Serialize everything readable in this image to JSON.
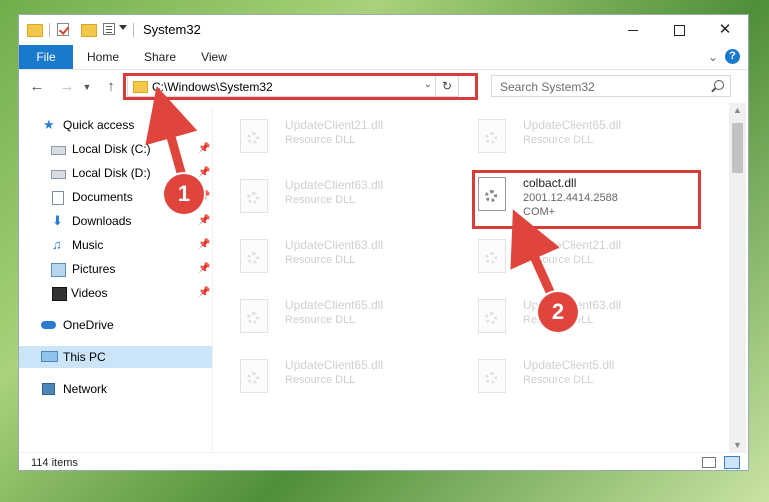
{
  "window": {
    "title": "System32",
    "controls": {
      "minimize": "",
      "maximize": "",
      "close": "✕"
    }
  },
  "ribbon": {
    "tabs": [
      "File",
      "Home",
      "Share",
      "View"
    ],
    "help": "?"
  },
  "navigation": {
    "address": "C:\\Windows\\System32",
    "search_placeholder": "Search System32"
  },
  "sidebar": {
    "items": [
      {
        "label": "Quick access",
        "icon": "star-icon",
        "pinned": false
      },
      {
        "label": "Local Disk (C:)",
        "icon": "disk-icon",
        "pinned": true
      },
      {
        "label": "Local Disk (D:)",
        "icon": "disk-icon",
        "pinned": true
      },
      {
        "label": "Documents",
        "icon": "documents-icon",
        "pinned": true
      },
      {
        "label": "Downloads",
        "icon": "download-icon",
        "pinned": true
      },
      {
        "label": "Music",
        "icon": "music-icon",
        "pinned": true
      },
      {
        "label": "Pictures",
        "icon": "pictures-icon",
        "pinned": true
      },
      {
        "label": "Videos",
        "icon": "videos-icon",
        "pinned": true
      },
      {
        "label": "OneDrive",
        "icon": "cloud-icon",
        "pinned": false
      },
      {
        "label": "This PC",
        "icon": "computer-icon",
        "pinned": false,
        "selected": true
      },
      {
        "label": "Network",
        "icon": "network-icon",
        "pinned": false
      }
    ]
  },
  "files": [
    {
      "name": "UpdateClient21.dll",
      "type": "Resource DLL"
    },
    {
      "name": "UpdateClient65.dll",
      "type": "Resource DLL"
    },
    {
      "name": "UpdateClient63.dll",
      "type": "Resource DLL"
    },
    {
      "name": "colbact.dll",
      "version": "2001.12.4414.2588",
      "type": "COM+",
      "highlighted": true
    },
    {
      "name": "UpdateClient63.dll",
      "type": "Resource DLL"
    },
    {
      "name": "UpdateClient21.dll",
      "type": "Resource DLL"
    },
    {
      "name": "UpdateClient65.dll",
      "type": "Resource DLL"
    },
    {
      "name": "UpdateClient63.dll",
      "type": "Resource DLL"
    },
    {
      "name": "UpdateClient65.dll",
      "type": "Resource DLL"
    },
    {
      "name": "UpdateClient5.dll",
      "type": "Resource DLL"
    }
  ],
  "status": {
    "item_count": "114 items"
  },
  "annotations": {
    "step1": "1",
    "step2": "2",
    "color": "#e0453d"
  }
}
